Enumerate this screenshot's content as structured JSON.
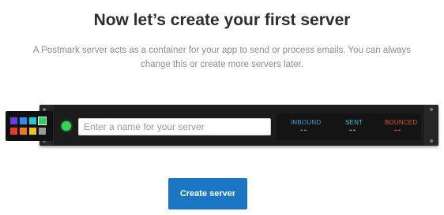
{
  "header": {
    "title": "Now let’s create your first server",
    "subtitle": "A Postmark server acts as a container for your app to send or process emails. You can always change this or create more servers later."
  },
  "server": {
    "name_placeholder": "Enter a name for your server",
    "name_value": "",
    "status_color": "#39d353",
    "palette": [
      "#6a3fd8",
      "#2b8ee8",
      "#1fc7d8",
      "#2bd158",
      "#e83a2c",
      "#f07a1f",
      "#f2c31b",
      "#9a9a9a"
    ],
    "selected_color_index": 3,
    "stats": [
      {
        "label": "INBOUND",
        "value": "--",
        "color": "#3ca3d6"
      },
      {
        "label": "SENT",
        "value": "--",
        "color": "#3cc4d6"
      },
      {
        "label": "BOUNCED",
        "value": "--",
        "color": "#d9583b"
      }
    ]
  },
  "actions": {
    "create_label": "Create server"
  }
}
